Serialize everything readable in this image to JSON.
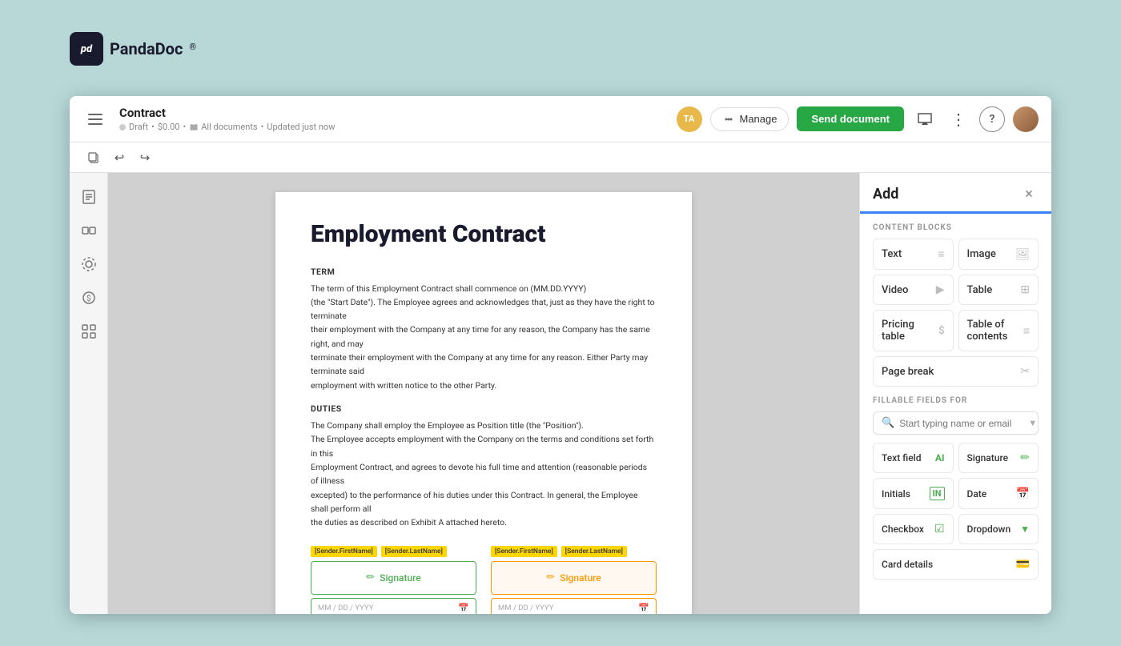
{
  "app": {
    "brand_name": "PandaDoc",
    "brand_symbol": "pd"
  },
  "header": {
    "menu_icon": "menu",
    "doc_title": "Contract",
    "doc_status": "Draft",
    "doc_price": "$0.00",
    "doc_location": "All documents",
    "doc_updated": "Updated just now",
    "avatar_initials": "TA",
    "manage_label": "Manage",
    "send_label": "Send document"
  },
  "toolbar": {
    "copy_title": "Copy",
    "undo_title": "Undo",
    "redo_title": "Redo"
  },
  "document": {
    "heading": "Employment Contract",
    "term_label": "TERM",
    "term_text": "The term of this Employment Contract shall commence on (MM.DD.YYYY)\n(the \"Start Date\"). The Employee agrees and acknowledges that, just as they have the right to terminate\ntheir employment with the Company at any time for any reason, the Company has the same right, and may\nterminate their employment with the Company at any time for any reason. Either Party may terminate said\nemployment with written notice to the other Party.",
    "duties_label": "DUTIES",
    "duties_text": "The Company shall employ the Employee as Position title (the \"Position\").\nThe Employee accepts employment with the Company on the terms and conditions set forth in this\nEmployment Contract, and agrees to devote his full time and attention (reasonable periods of illness\nexcepted) to the performance of his duties under this Contract. In general, the Employee shall perform all\nthe duties as described on Exhibit A attached hereto.",
    "sig1_names": [
      "[Sender.FirstName]",
      "[Sender.LastName]"
    ],
    "sig2_names": [
      "[Sender.FirstName]",
      "[Sender.LastName]"
    ],
    "sig1_label": "Signature",
    "sig2_label": "Signature",
    "date_placeholder": "MM / DD / YYYY"
  },
  "right_panel": {
    "title": "Add",
    "close_icon": "×",
    "content_blocks_label": "CONTENT BLOCKS",
    "blocks": [
      {
        "id": "text",
        "label": "Text",
        "icon": "≡"
      },
      {
        "id": "image",
        "label": "Image",
        "icon": "🖼"
      },
      {
        "id": "video",
        "label": "Video",
        "icon": "▶"
      },
      {
        "id": "table",
        "label": "Table",
        "icon": "⊞"
      },
      {
        "id": "pricing_table",
        "label": "Pricing table",
        "icon": "$≡"
      },
      {
        "id": "table_of_contents",
        "label": "Table of contents",
        "icon": "≡"
      },
      {
        "id": "page_break",
        "label": "Page break",
        "icon": "✂"
      }
    ],
    "fillable_fields_label": "FILLABLE FIELDS FOR",
    "search_placeholder": "Start typing name or email",
    "fields": [
      {
        "id": "text_field",
        "label": "Text field",
        "icon": "AI"
      },
      {
        "id": "signature",
        "label": "Signature",
        "icon": "✏"
      },
      {
        "id": "initials",
        "label": "Initials",
        "icon": "IN"
      },
      {
        "id": "date",
        "label": "Date",
        "icon": "📅"
      },
      {
        "id": "checkbox",
        "label": "Checkbox",
        "icon": "☑"
      },
      {
        "id": "dropdown",
        "label": "Dropdown",
        "icon": "⊞"
      },
      {
        "id": "card_details",
        "label": "Card details",
        "icon": "💳"
      }
    ]
  }
}
